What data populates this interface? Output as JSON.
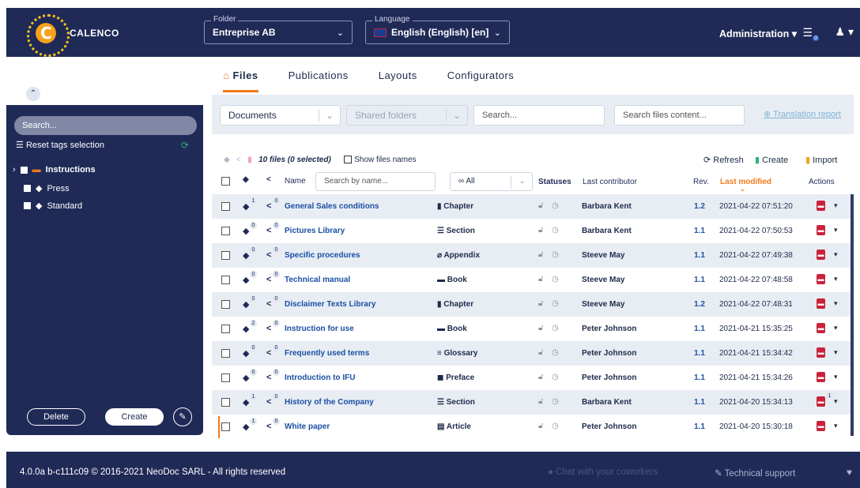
{
  "app": {
    "logo_letter": "C",
    "logo_text": "CALENCO"
  },
  "header": {
    "folder_label": "Folder",
    "folder_value": "Entreprise AB",
    "language_label": "Language",
    "language_value": "English (English) [en]",
    "admin_label": "Administration",
    "notif_count": "0"
  },
  "tabs": [
    {
      "label": "Files",
      "active": true
    },
    {
      "label": "Publications"
    },
    {
      "label": "Layouts"
    },
    {
      "label": "Configurators"
    }
  ],
  "sidebar": {
    "search_placeholder": "Search...",
    "reset_label": "Reset tags selection",
    "tree": [
      {
        "label": "Instructions",
        "bold": true
      },
      {
        "label": "Press"
      },
      {
        "label": "Standard"
      }
    ],
    "delete_label": "Delete",
    "create_label": "Create"
  },
  "filters": {
    "documents": "Documents",
    "shared": "Shared folders",
    "search_placeholder": "Search...",
    "content_placeholder": "Search files content...",
    "translation_report": "Translation report"
  },
  "toolbar": {
    "count_text": "10 files (0 selected)",
    "show_names": "Show files names",
    "refresh": "Refresh",
    "create": "Create",
    "import": "Import"
  },
  "columns": {
    "name": "Name",
    "name_placeholder": "Search by name...",
    "type_filter": "All",
    "statuses": "Statuses",
    "last_contributor": "Last contributor",
    "rev": "Rev.",
    "last_modified": "Last modified",
    "actions": "Actions"
  },
  "rows": [
    {
      "tags": "1",
      "shares": "0",
      "name": "General Sales conditions",
      "type_icon": "▮",
      "type": "Chapter",
      "contributor": "Barbara Kent",
      "rev": "1.2",
      "modified": "2021-04-22 07:51:20",
      "pdf_badge": ""
    },
    {
      "tags": "0",
      "shares": "0",
      "name": "Pictures Library",
      "type_icon": "☰",
      "type": "Section",
      "contributor": "Barbara Kent",
      "rev": "1.1",
      "modified": "2021-04-22 07:50:53",
      "pdf_badge": ""
    },
    {
      "tags": "0",
      "shares": "0",
      "name": "Specific procedures",
      "type_icon": "⌀",
      "type": "Appendix",
      "contributor": "Steeve May",
      "rev": "1.1",
      "modified": "2021-04-22 07:49:38",
      "pdf_badge": ""
    },
    {
      "tags": "0",
      "shares": "0",
      "name": "Technical manual",
      "type_icon": "▬",
      "type": "Book",
      "contributor": "Steeve May",
      "rev": "1.1",
      "modified": "2021-04-22 07:48:58",
      "pdf_badge": ""
    },
    {
      "tags": "0",
      "shares": "0",
      "name": "Disclaimer Texts Library",
      "type_icon": "▮",
      "type": "Chapter",
      "contributor": "Steeve May",
      "rev": "1.2",
      "modified": "2021-04-22 07:48:31",
      "pdf_badge": ""
    },
    {
      "tags": "2",
      "shares": "0",
      "name": "Instruction for use",
      "type_icon": "▬",
      "type": "Book",
      "contributor": "Peter Johnson",
      "rev": "1.1",
      "modified": "2021-04-21 15:35:25",
      "pdf_badge": ""
    },
    {
      "tags": "0",
      "shares": "0",
      "name": "Frequently used terms",
      "type_icon": "≡",
      "type": "Glossary",
      "contributor": "Peter Johnson",
      "rev": "1.1",
      "modified": "2021-04-21 15:34:42",
      "pdf_badge": ""
    },
    {
      "tags": "0",
      "shares": "0",
      "name": "Introduction to IFU",
      "type_icon": "◼",
      "type": "Preface",
      "contributor": "Peter Johnson",
      "rev": "1.1",
      "modified": "2021-04-21 15:34:26",
      "pdf_badge": ""
    },
    {
      "tags": "1",
      "shares": "0",
      "name": "History of the Company",
      "type_icon": "☰",
      "type": "Section",
      "contributor": "Barbara Kent",
      "rev": "1.1",
      "modified": "2021-04-20 15:34:13",
      "pdf_badge": "1"
    },
    {
      "tags": "1",
      "shares": "0",
      "name": "White paper",
      "type_icon": "▤",
      "type": "Article",
      "contributor": "Peter Johnson",
      "rev": "1.1",
      "modified": "2021-04-20 15:30:18",
      "pdf_badge": ""
    }
  ],
  "footer": {
    "copyright": "4.0.0a b-c111c09 © 2016-2021 NeoDoc SARL - All rights reserved",
    "chat": "Chat with your coworkers",
    "support": "Technical support"
  },
  "colors": {
    "navy": "#1f2a57",
    "accent": "#f07a1a",
    "link": "#1a4fa3",
    "pdf": "#c8233a",
    "green": "#2eb37e"
  }
}
